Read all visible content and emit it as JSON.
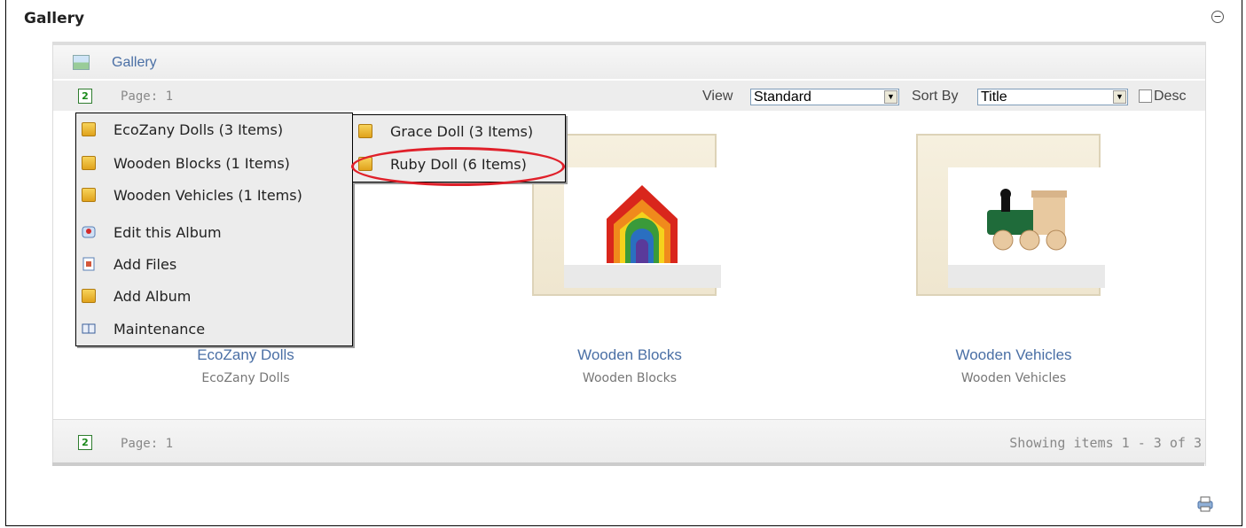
{
  "module": {
    "title": "Gallery"
  },
  "breadcrumb": {
    "label": "Gallery"
  },
  "pager_top": {
    "page_label": "Page: 1"
  },
  "controls": {
    "view_label": "View",
    "view_value": "Standard",
    "sort_label": "Sort By",
    "sort_value": "Title",
    "desc_label": "Desc"
  },
  "albums": [
    {
      "title": "EcoZany Dolls",
      "description": "EcoZany Dolls"
    },
    {
      "title": "Wooden Blocks",
      "description": "Wooden Blocks"
    },
    {
      "title": "Wooden Vehicles",
      "description": "Wooden Vehicles"
    }
  ],
  "pager_bottom": {
    "page_label": "Page: 1",
    "showing": "Showing items 1 - 3 of 3"
  },
  "context_menu": {
    "items": [
      {
        "label": "EcoZany Dolls (3 Items)",
        "icon": "folder-icon"
      },
      {
        "label": "Wooden Blocks (1 Items)",
        "icon": "folder-icon"
      },
      {
        "label": "Wooden Vehicles (1 Items)",
        "icon": "folder-icon"
      },
      {
        "label": "Edit this Album",
        "icon": "edit-album-icon"
      },
      {
        "label": "Add Files",
        "icon": "add-files-icon"
      },
      {
        "label": "Add Album",
        "icon": "folder-icon"
      },
      {
        "label": "Maintenance",
        "icon": "book-icon"
      }
    ]
  },
  "submenu": {
    "items": [
      {
        "label": "Grace Doll (3 Items)",
        "icon": "folder-icon"
      },
      {
        "label": "Ruby Doll (6 Items)",
        "icon": "folder-icon"
      }
    ]
  },
  "colors": {
    "link": "#4a6fa5",
    "highlight_ring": "#e0202a"
  }
}
